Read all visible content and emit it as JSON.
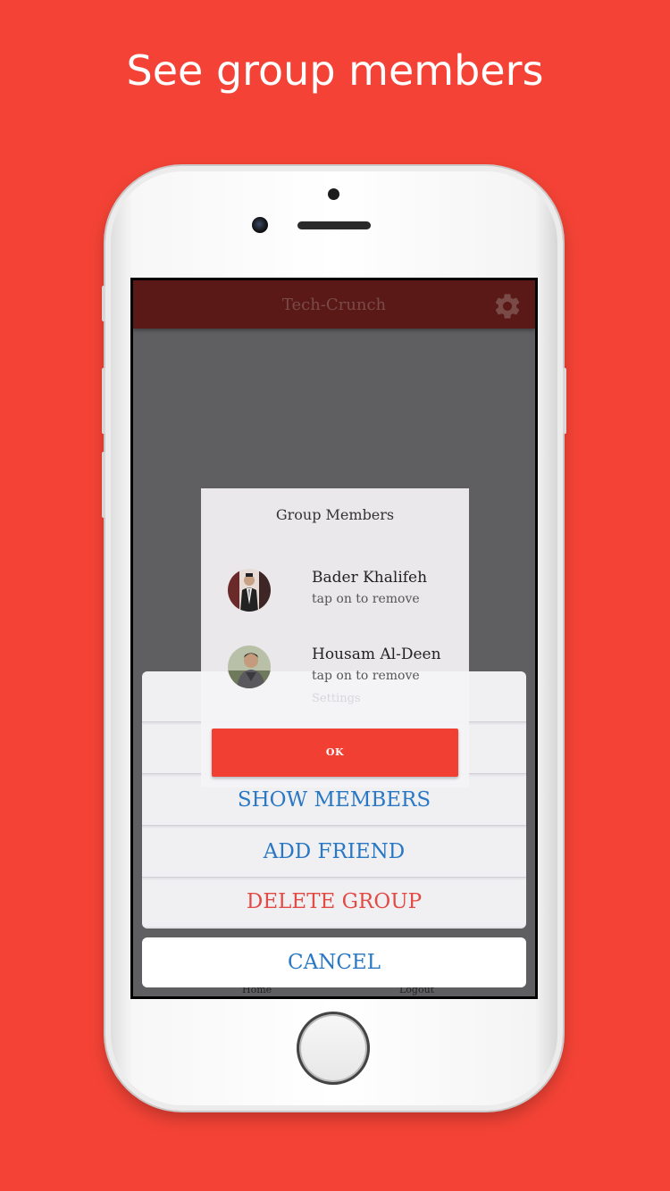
{
  "headline": "See group members",
  "app": {
    "title": "Tech-Crunch",
    "settings_icon": "gear-icon"
  },
  "dialog": {
    "title": "Group Members",
    "members": [
      {
        "name": "Bader Khalifeh",
        "hint": "tap on to remove"
      },
      {
        "name": "Housam Al-Deen",
        "hint": "tap on to remove"
      }
    ],
    "faded_text": "Settings",
    "ok_label": "OK"
  },
  "action_sheet": {
    "show_members": "SHOW MEMBERS",
    "add_friend": "ADD FRIEND",
    "delete_group": "DELETE GROUP",
    "cancel": "CANCEL"
  },
  "bottom_nav": {
    "home": "Home",
    "logout": "Logout"
  },
  "colors": {
    "background": "#f44336",
    "appbar": "#5a1916",
    "action_blue": "#2a78c4",
    "danger_red": "#e34a45",
    "ok_button": "#f23f34"
  }
}
